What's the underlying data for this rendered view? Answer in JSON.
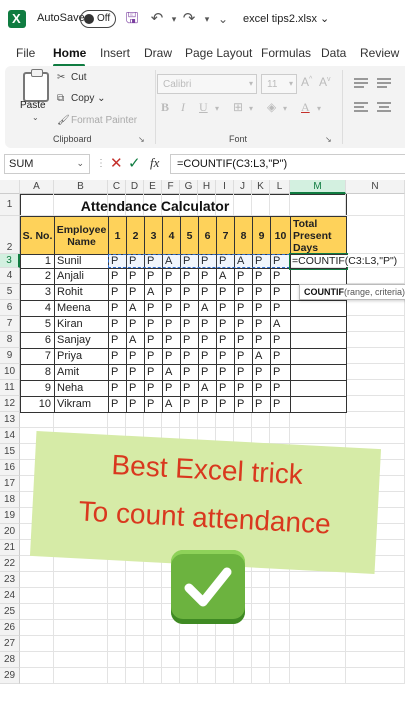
{
  "titlebar": {
    "autosave_label": "AutoSave",
    "autosave_state": "Off",
    "filename": "excel tips2.xlsx",
    "filename_chevron": "⌄"
  },
  "tabs": [
    "File",
    "Home",
    "Insert",
    "Draw",
    "Page Layout",
    "Formulas",
    "Data",
    "Review"
  ],
  "active_tab": "Home",
  "ribbon": {
    "clipboard": {
      "paste_label": "Paste",
      "cut_label": "Cut",
      "copy_label": "Copy",
      "format_painter_label": "Format Painter",
      "group_label": "Clipboard"
    },
    "font": {
      "font_name": "Calibri",
      "font_size": "11",
      "group_label": "Font"
    }
  },
  "formula_bar": {
    "name_box": "SUM",
    "formula": "=COUNTIF(C3:L3,\"P\")"
  },
  "grid": {
    "columns": [
      "A",
      "B",
      "C",
      "D",
      "E",
      "F",
      "G",
      "H",
      "I",
      "J",
      "K",
      "L",
      "M",
      "N"
    ],
    "row_numbers": [
      "1",
      "2",
      "3",
      "4",
      "5",
      "6",
      "7",
      "8",
      "9",
      "10",
      "11",
      "12",
      "13",
      "14",
      "15",
      "16",
      "17",
      "18",
      "19",
      "20",
      "21",
      "22",
      "23",
      "24",
      "25",
      "26",
      "27",
      "28",
      "29"
    ],
    "title": "Attendance Calculator",
    "headers": {
      "sno": "S. No.",
      "employee_line1": "Employee",
      "employee_line2": "Name",
      "days": [
        "1",
        "2",
        "3",
        "4",
        "5",
        "6",
        "7",
        "8",
        "9",
        "10"
      ],
      "total_line1": "Total",
      "total_line2": "Present",
      "total_line3": "Days"
    },
    "rows": [
      {
        "sno": "1",
        "name": "Sunil",
        "days": [
          "P",
          "P",
          "P",
          "A",
          "P",
          "P",
          "P",
          "A",
          "P",
          "P"
        ]
      },
      {
        "sno": "2",
        "name": "Anjali",
        "days": [
          "P",
          "P",
          "P",
          "P",
          "P",
          "P",
          "A",
          "P",
          "P",
          "P"
        ]
      },
      {
        "sno": "3",
        "name": "Rohit",
        "days": [
          "P",
          "P",
          "A",
          "P",
          "P",
          "P",
          "P",
          "P",
          "P",
          "P"
        ]
      },
      {
        "sno": "4",
        "name": "Meena",
        "days": [
          "P",
          "A",
          "P",
          "P",
          "P",
          "A",
          "P",
          "P",
          "P",
          "P"
        ]
      },
      {
        "sno": "5",
        "name": "Kiran",
        "days": [
          "P",
          "P",
          "P",
          "P",
          "P",
          "P",
          "P",
          "P",
          "P",
          "A"
        ]
      },
      {
        "sno": "6",
        "name": "Sanjay",
        "days": [
          "P",
          "A",
          "P",
          "P",
          "P",
          "P",
          "P",
          "P",
          "P",
          "P"
        ]
      },
      {
        "sno": "7",
        "name": "Priya",
        "days": [
          "P",
          "P",
          "P",
          "P",
          "P",
          "P",
          "P",
          "P",
          "A",
          "P"
        ]
      },
      {
        "sno": "8",
        "name": "Amit",
        "days": [
          "P",
          "P",
          "P",
          "A",
          "P",
          "P",
          "P",
          "P",
          "P",
          "P"
        ]
      },
      {
        "sno": "9",
        "name": "Neha",
        "days": [
          "P",
          "P",
          "P",
          "P",
          "P",
          "A",
          "P",
          "P",
          "P",
          "P"
        ]
      },
      {
        "sno": "10",
        "name": "Vikram",
        "days": [
          "P",
          "P",
          "P",
          "A",
          "P",
          "P",
          "P",
          "P",
          "P",
          "P"
        ]
      }
    ],
    "active_cell_text": "=COUNTIF(C3:L3,\"P\")",
    "tooltip": {
      "function": "COUNTIF",
      "args": "(range, criteria)"
    }
  },
  "overlay": {
    "line1": "Best Excel trick",
    "line2": "To count attendance",
    "icon": "check-mark-button-icon"
  },
  "colors": {
    "excel_green": "#107c41",
    "header_fill": "#fed25a",
    "banner_bg": "#d6eba7",
    "banner_text": "#d9381e",
    "check_green": "#6cb33f"
  }
}
